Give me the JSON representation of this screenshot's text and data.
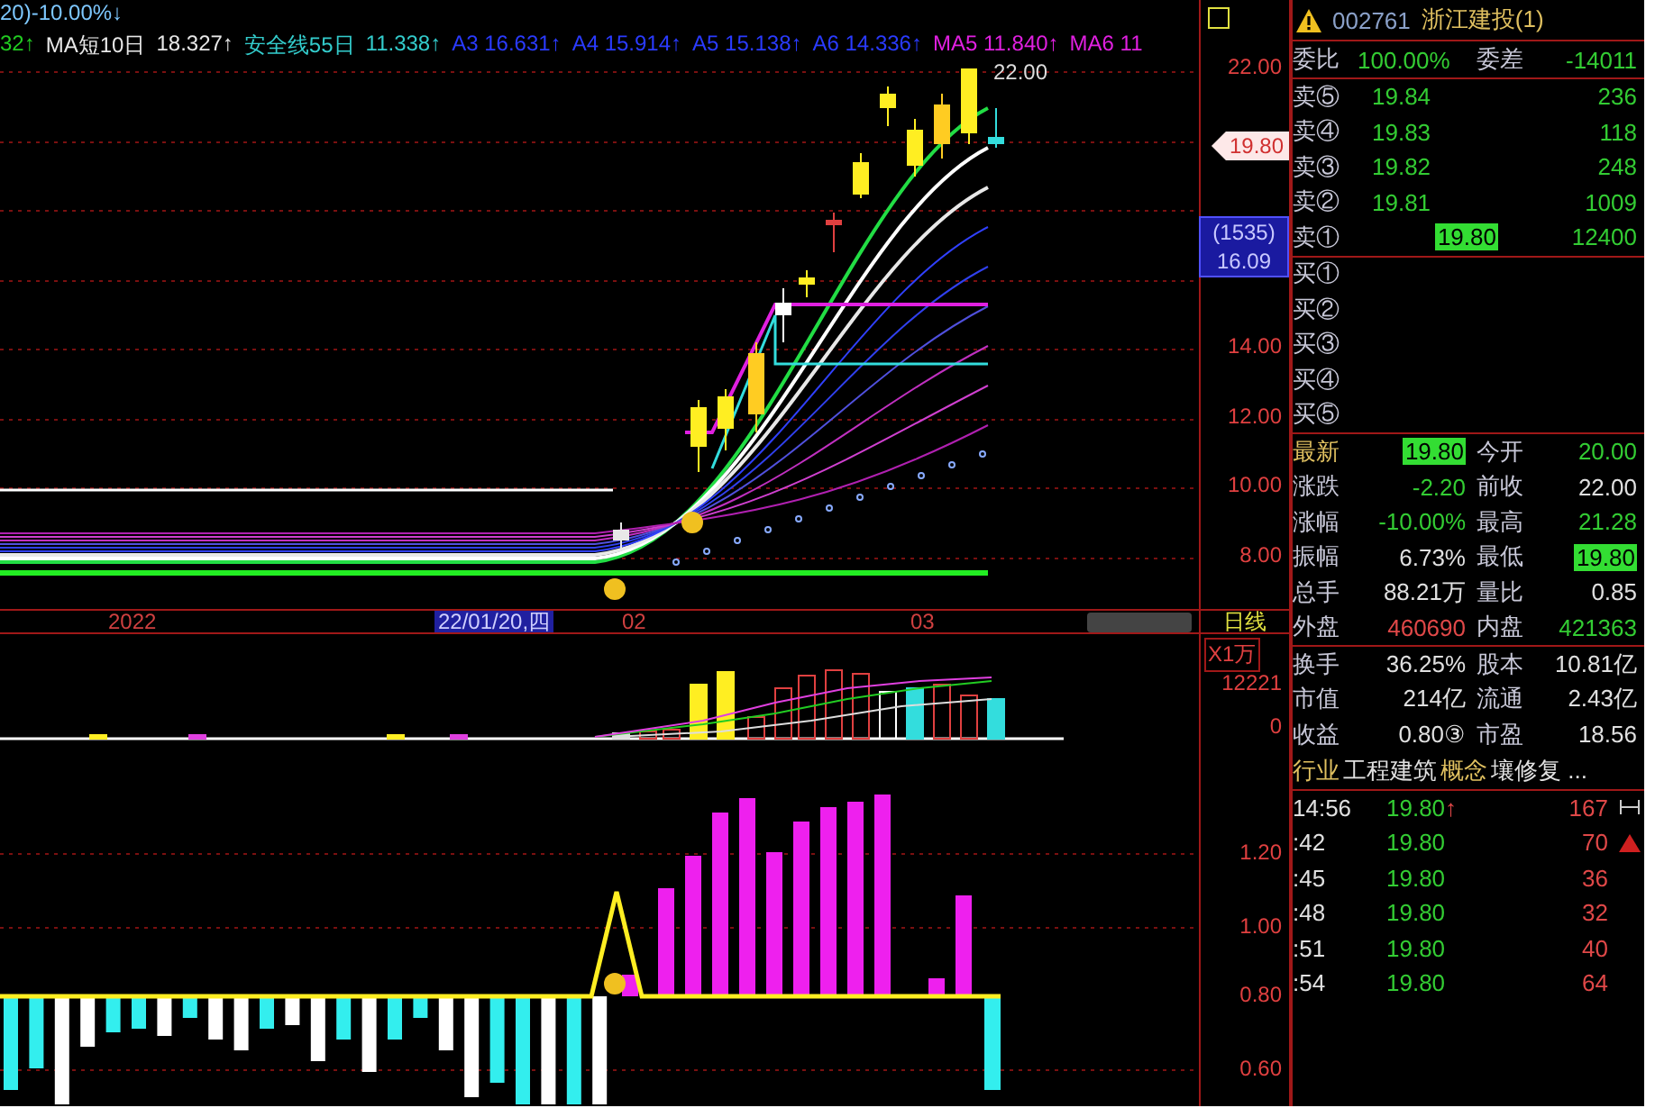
{
  "legend_top": {
    "text": "20)-10.00%↓"
  },
  "legend": [
    {
      "text": "32↑",
      "color": "#22cc22"
    },
    {
      "text": "MA短10日",
      "color": "#e8e8e8"
    },
    {
      "text": "18.327↑",
      "color": "#e8e8e8"
    },
    {
      "text": "安全线55日",
      "color": "#33cccc"
    },
    {
      "text": "11.338↑",
      "color": "#33cccc"
    },
    {
      "text": "A3 16.631↑",
      "color": "#2a3bff"
    },
    {
      "text": "A4 15.914↑",
      "color": "#2a3bff"
    },
    {
      "text": "A5 15.138↑",
      "color": "#2a3bff"
    },
    {
      "text": "A6 14.336↑",
      "color": "#2a3bff"
    },
    {
      "text": "MA5 11.840↑",
      "color": "#e020e0"
    },
    {
      "text": "MA6 11",
      "color": "#e020e0"
    }
  ],
  "price_chart": {
    "peak_label": "22.00"
  },
  "price_axis": {
    "ticks": [
      "22.00",
      "14.00",
      "12.00",
      "10.00",
      "8.00"
    ],
    "last_price": "19.80",
    "cursor_count": "(1535)",
    "cursor_price": "16.09"
  },
  "date_bar": {
    "labels": [
      "2022",
      "02",
      "03"
    ],
    "cursor_date": "22/01/20,四",
    "period": "日线"
  },
  "volume_axis": {
    "unit": "X1万",
    "ticks": [
      "12221",
      "0"
    ]
  },
  "indicator_axis": {
    "ticks": [
      "1.20",
      "1.00",
      "0.80",
      "0.60"
    ]
  },
  "panel": {
    "code": "002761",
    "name": "浙江建投(1)",
    "ratio": {
      "label": "委比",
      "value": "100.00%",
      "diff_label": "委差",
      "diff": "-14011"
    },
    "asks": [
      {
        "label": "卖⑤",
        "price": "19.84",
        "volume": "236",
        "highlight": false
      },
      {
        "label": "卖④",
        "price": "19.83",
        "volume": "118",
        "highlight": false
      },
      {
        "label": "卖③",
        "price": "19.82",
        "volume": "248",
        "highlight": false
      },
      {
        "label": "卖②",
        "price": "19.81",
        "volume": "1009",
        "highlight": false
      },
      {
        "label": "卖①",
        "price": "19.80",
        "volume": "12400",
        "highlight": true
      }
    ],
    "bids": [
      {
        "label": "买①"
      },
      {
        "label": "买②"
      },
      {
        "label": "买③"
      },
      {
        "label": "买④"
      },
      {
        "label": "买⑤"
      }
    ],
    "quotes": [
      {
        "label": "最新",
        "value": "19.80",
        "color": "#33dd33",
        "highlight": true
      },
      {
        "label": "今开",
        "value": "20.00",
        "color": "#33cc33",
        "highlight": false
      },
      {
        "label": "涨跌",
        "value": "-2.20",
        "color": "#33cc33",
        "highlight": false
      },
      {
        "label": "前收",
        "value": "22.00",
        "color": "#e0e0e0",
        "highlight": false
      },
      {
        "label": "涨幅",
        "value": "-10.00%",
        "color": "#33cc33",
        "highlight": false
      },
      {
        "label": "最高",
        "value": "21.28",
        "color": "#33cc33",
        "highlight": false
      },
      {
        "label": "振幅",
        "value": "6.73%",
        "color": "#e0e0e0",
        "highlight": false
      },
      {
        "label": "最低",
        "value": "19.80",
        "color": "#33dd33",
        "highlight": true
      },
      {
        "label": "总手",
        "value": "88.21万",
        "color": "#e0e0e0",
        "highlight": false
      },
      {
        "label": "量比",
        "value": "0.85",
        "color": "#e0e0e0",
        "highlight": false
      },
      {
        "label": "外盘",
        "value": "460690",
        "color": "#e04848",
        "highlight": false
      },
      {
        "label": "内盘",
        "value": "421363",
        "color": "#33cc33",
        "highlight": false
      }
    ],
    "stats": [
      {
        "label": "换手",
        "value": "36.25%",
        "label2": "股本",
        "value2": "10.81亿"
      },
      {
        "label": "市值",
        "value": "214亿",
        "label2": "流通",
        "value2": "2.43亿"
      },
      {
        "label": "收益",
        "value": "0.80③",
        "label2": "市盈",
        "value2": "18.56"
      }
    ],
    "industry": {
      "label": "行业",
      "value": "工程建筑",
      "concept_label": "概念",
      "concept_value": "壤修复 ..."
    },
    "trades": [
      {
        "time": "14:56",
        "price": "19.80",
        "mark": "↑",
        "volume": "167"
      },
      {
        "time": ":42",
        "price": "19.80",
        "volume": "70"
      },
      {
        "time": ":45",
        "price": "19.80",
        "volume": "36"
      },
      {
        "time": ":48",
        "price": "19.80",
        "volume": "32"
      },
      {
        "time": ":51",
        "price": "19.80",
        "volume": "40"
      },
      {
        "time": ":54",
        "price": "19.80",
        "volume": "64"
      }
    ]
  }
}
